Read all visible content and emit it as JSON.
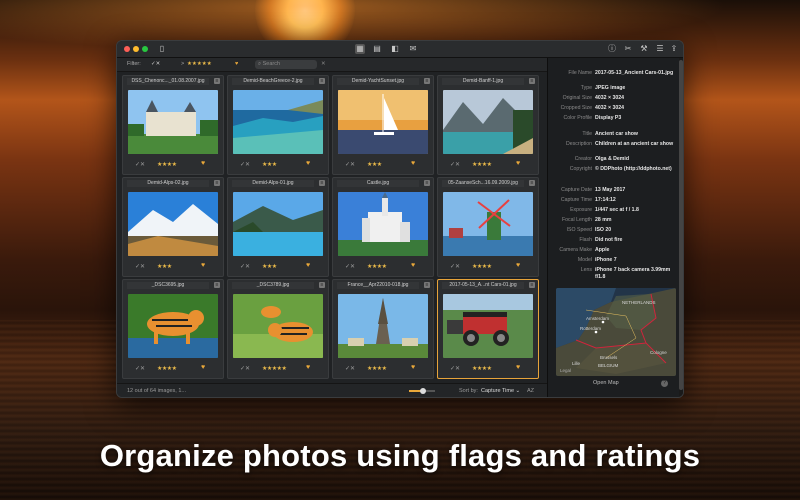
{
  "toolbar": {
    "left_icons": [
      "sidebar-icon"
    ],
    "view_icons": [
      "grid-view-icon",
      "browse-view-icon",
      "split-view-icon",
      "mail-icon"
    ],
    "right_icons": [
      "info-icon",
      "adjust-icon",
      "tools-icon",
      "settings-icon",
      "share-icon"
    ]
  },
  "filterbar": {
    "label": "Filter:",
    "flag_symbols": "✓✕",
    "rating_op": ">",
    "rating_stars": "★★★★★",
    "heart": "♥",
    "search_placeholder": "Search",
    "clear": "✕"
  },
  "photos": [
    {
      "name": "DSS_Chenonc..._01.08.2007.jpg",
      "stars": "★★★★",
      "selected": false
    },
    {
      "name": "Demid-BeachGreece-2.jpg",
      "stars": "★★★",
      "selected": false
    },
    {
      "name": "Demid-YachtSunset.jpg",
      "stars": "★★★",
      "selected": false
    },
    {
      "name": "Demid-Banff-1.jpg",
      "stars": "★★★★",
      "selected": false
    },
    {
      "name": "Demid-Alps-02.jpg",
      "stars": "★★★",
      "selected": false
    },
    {
      "name": "Demid-Alps-01.jpg",
      "stars": "★★★",
      "selected": false
    },
    {
      "name": "Castle.jpg",
      "stars": "★★★★",
      "selected": false
    },
    {
      "name": "05-ZaanseSch...16.09.2009.jpg",
      "stars": "★★★★",
      "selected": false
    },
    {
      "name": "_DSC3695.jpg",
      "stars": "★★★★",
      "selected": false
    },
    {
      "name": "_DSC3789.jpg",
      "stars": "★★★★★",
      "selected": false
    },
    {
      "name": "France__Apr22010-018.jpg",
      "stars": "★★★★",
      "selected": false
    },
    {
      "name": "2017-05-13_A...nt Cars-01.jpg",
      "stars": "★★★★",
      "selected": true
    }
  ],
  "cell_controls": {
    "flag": "✓✕",
    "heart": "♥",
    "menu": "≡"
  },
  "statusbar": {
    "count": "12 out of 64 images, 1...",
    "zoom_fraction": 0.55,
    "sort_label": "Sort by:",
    "sort_value": "Capture Time ⌄",
    "sort_dir": "AZ"
  },
  "info": {
    "rows": [
      {
        "k": "File Name",
        "v": "2017-05-13_Ancient Cars-01.jpg"
      },
      {
        "k": "Type",
        "v": "JPEG image"
      },
      {
        "k": "Original Size",
        "v": "4032 × 3024"
      },
      {
        "k": "Cropped Size",
        "v": "4032 × 3024"
      },
      {
        "k": "Color Profile",
        "v": "Display P3"
      },
      {
        "k": "Title",
        "v": "Ancient car show"
      },
      {
        "k": "Description",
        "v": "Children at an ancient car show"
      },
      {
        "k": "Creator",
        "v": "Olga & Demid"
      },
      {
        "k": "Copyright",
        "v": "© DDPhoto (http://ddphoto.net)"
      },
      {
        "k": "Capture Date",
        "v": "13 May 2017"
      },
      {
        "k": "Capture Time",
        "v": "17:14:12"
      },
      {
        "k": "Exposure",
        "v": "1/447 sec at f / 1.8"
      },
      {
        "k": "Focal Length",
        "v": "28 mm"
      },
      {
        "k": "ISO Speed",
        "v": "ISO 20"
      },
      {
        "k": "Flash",
        "v": "Did not fire"
      },
      {
        "k": "Camera Make",
        "v": "Apple"
      },
      {
        "k": "Model",
        "v": "iPhone 7"
      },
      {
        "k": "Lens",
        "v": "iPhone 7 back camera 3.99mm f/1.8"
      }
    ],
    "map_labels": [
      "NETHERLANDS",
      "Amsterdam",
      "Rotterdam",
      "Cologne",
      "Brussels",
      "BELGIUM",
      "Lille",
      "Legal"
    ],
    "open_map": "Open Map",
    "help": "?"
  },
  "caption": "Organize photos using flags and ratings",
  "colors": {
    "accent": "#e9a83a",
    "stars": "#e9b94a",
    "window_bg": "#202224"
  }
}
